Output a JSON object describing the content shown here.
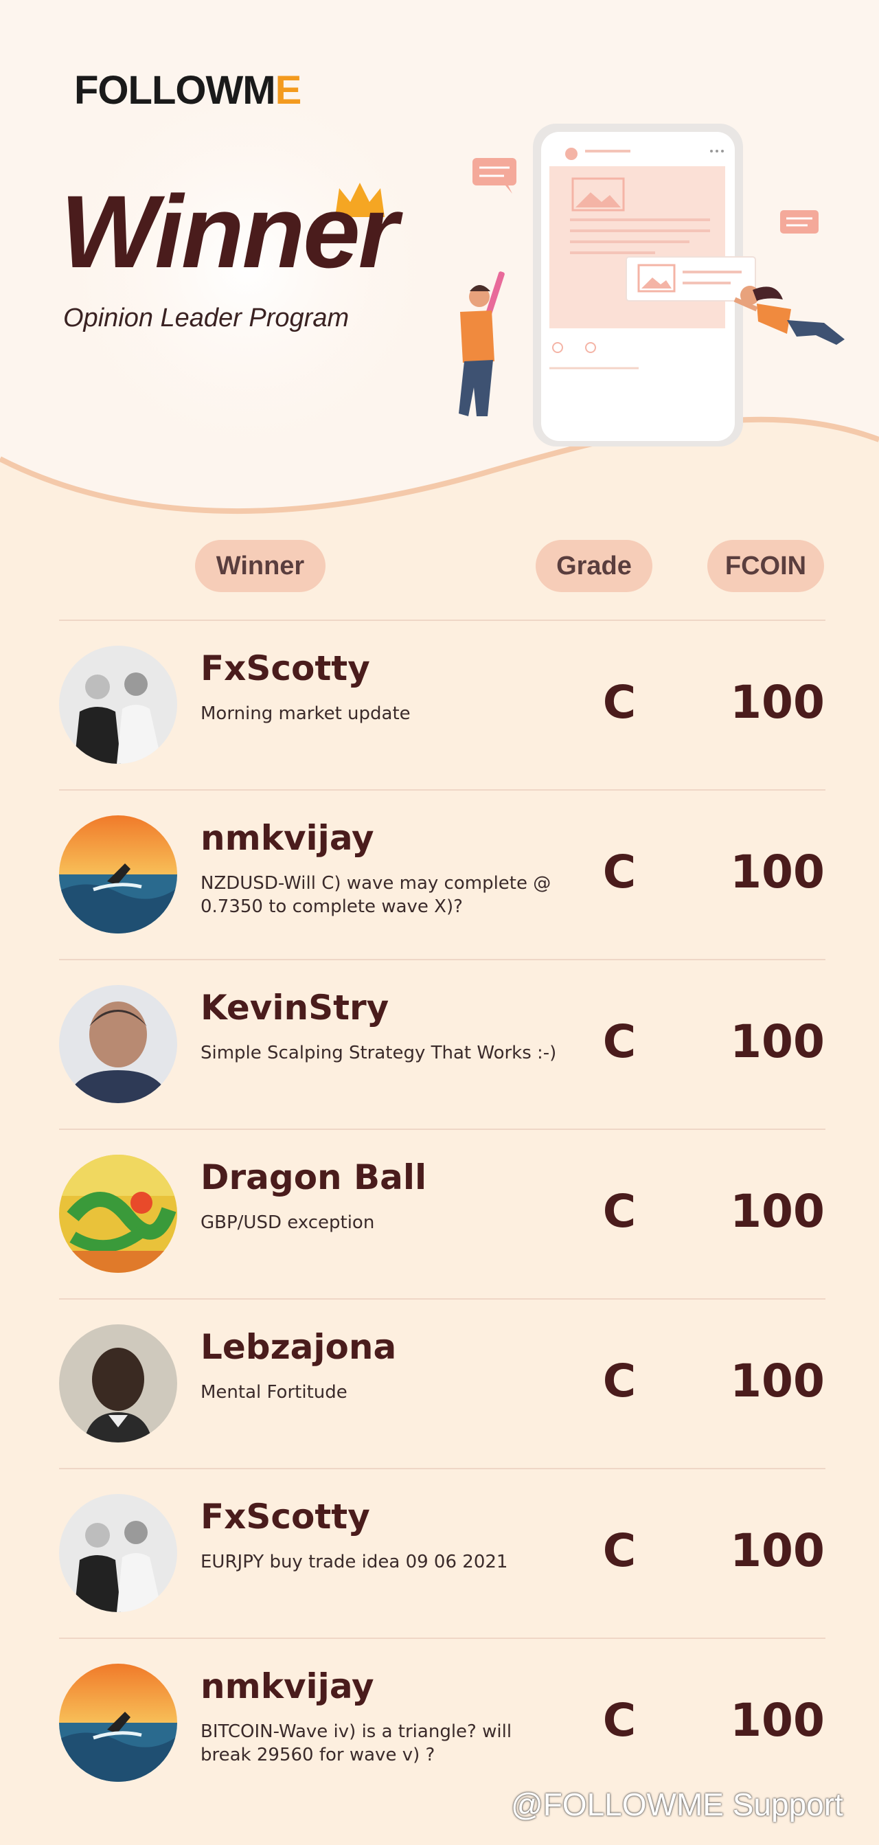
{
  "brand": {
    "logo_prefix": "FOLLOWM",
    "logo_accent": "E",
    "accent_color": "#f39a1e"
  },
  "hero": {
    "title": "Winner",
    "subtitle": "Opinion Leader Program"
  },
  "table": {
    "headers": {
      "winner": "Winner",
      "grade": "Grade",
      "fcoin": "FCOIN"
    },
    "rows": [
      {
        "user": "FxScotty",
        "post": "Morning market update",
        "grade": "C",
        "fcoin": "100",
        "avatar": "couple-photo"
      },
      {
        "user": "nmkvijay",
        "post": "NZDUSD-Will C) wave may complete @ 0.7350 to complete wave X)?",
        "grade": "C",
        "fcoin": "100",
        "avatar": "surfer-sunset"
      },
      {
        "user": "KevinStry",
        "post": "Simple Scalping Strategy That Works :-)",
        "grade": "C",
        "fcoin": "100",
        "avatar": "man-portrait"
      },
      {
        "user": "Dragon Ball",
        "post": "GBP/USD exception",
        "grade": "C",
        "fcoin": "100",
        "avatar": "dragon-art"
      },
      {
        "user": "Lebzajona",
        "post": "Mental Fortitude",
        "grade": "C",
        "fcoin": "100",
        "avatar": "man-portrait-dark"
      },
      {
        "user": "FxScotty",
        "post": "EURJPY buy trade idea 09 06 2021",
        "grade": "C",
        "fcoin": "100",
        "avatar": "couple-photo"
      },
      {
        "user": "nmkvijay",
        "post": "BITCOIN-Wave iv) is a triangle? will break 29560 for wave v) ?",
        "grade": "C",
        "fcoin": "100",
        "avatar": "surfer-sunset"
      }
    ]
  },
  "watermark": "@FOLLOWME Support"
}
